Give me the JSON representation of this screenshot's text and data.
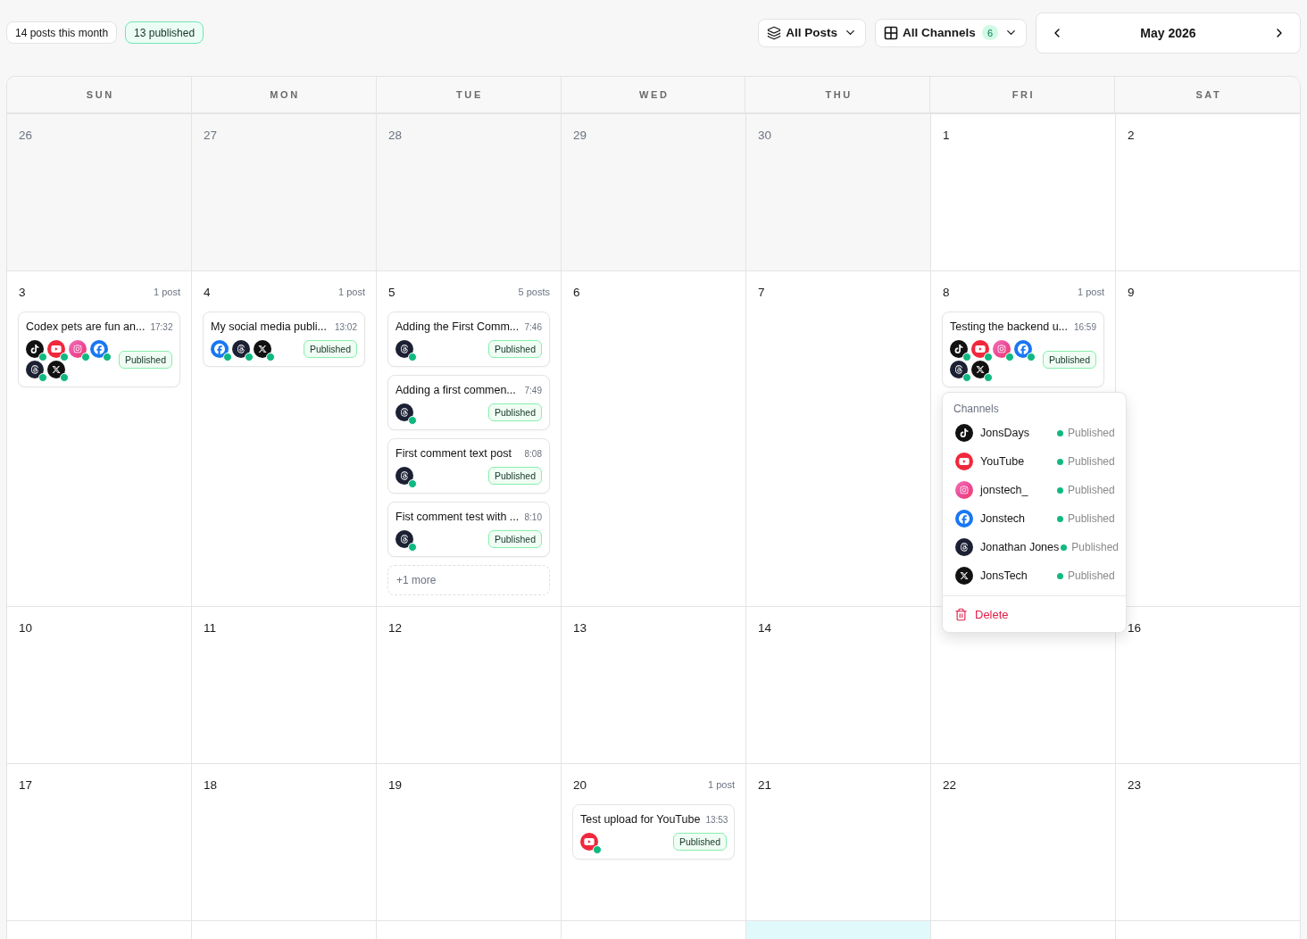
{
  "summary": {
    "posts_total": "14 posts this month",
    "published_total": "13 published"
  },
  "filters": [
    {
      "kind": "posts",
      "label": "All Posts"
    },
    {
      "kind": "channels",
      "label": "All Channels",
      "count": "6"
    }
  ],
  "month_nav": {
    "label": "May 2026"
  },
  "calendar": {
    "weekdays": [
      "SUN",
      "MON",
      "TUE",
      "WED",
      "THU",
      "FRI",
      "SAT"
    ],
    "weeks": [
      {
        "days": [
          {
            "number": "26",
            "outside_month": true,
            "today": false
          },
          {
            "number": "27",
            "outside_month": true,
            "today": false
          },
          {
            "number": "28",
            "outside_month": true,
            "today": false
          },
          {
            "number": "29",
            "outside_month": true,
            "today": false
          },
          {
            "number": "30",
            "outside_month": true,
            "today": false
          },
          {
            "number": "1",
            "outside_month": false,
            "today": false
          },
          {
            "number": "2",
            "outside_month": false,
            "today": false
          }
        ]
      },
      {
        "days": [
          {
            "number": "3",
            "outside_month": false,
            "today": false,
            "post_count": "1 post",
            "posts": [
              {
                "title": "Codex pets are fun an...",
                "time": "17:32",
                "status": "Published",
                "channels": [
                  {
                    "kind": "tiktok",
                    "published": true
                  },
                  {
                    "kind": "youtube",
                    "published": true
                  },
                  {
                    "kind": "instagram",
                    "published": true
                  },
                  {
                    "kind": "facebook",
                    "published": true
                  },
                  {
                    "kind": "threads",
                    "published": true
                  },
                  {
                    "kind": "x",
                    "published": true
                  }
                ]
              }
            ]
          },
          {
            "number": "4",
            "outside_month": false,
            "today": false,
            "post_count": "1 post",
            "posts": [
              {
                "title": "My social media publi...",
                "time": "13:02",
                "status": "Published",
                "channels": [
                  {
                    "kind": "facebook",
                    "published": true
                  },
                  {
                    "kind": "threads",
                    "published": true
                  },
                  {
                    "kind": "x",
                    "published": true
                  }
                ]
              }
            ]
          },
          {
            "number": "5",
            "outside_month": false,
            "today": false,
            "post_count": "5 posts",
            "posts": [
              {
                "title": "Adding the First Comm...",
                "time": "7:46",
                "status": "Published",
                "channels": [
                  {
                    "kind": "threads",
                    "published": true
                  }
                ]
              },
              {
                "title": "Adding a first commen...",
                "time": "7:49",
                "status": "Published",
                "channels": [
                  {
                    "kind": "threads",
                    "published": true
                  }
                ]
              },
              {
                "title": "First comment text post",
                "time": "8:08",
                "status": "Published",
                "channels": [
                  {
                    "kind": "threads",
                    "published": true
                  }
                ]
              },
              {
                "title": "Fist comment test with ...",
                "time": "8:10",
                "status": "Published",
                "channels": [
                  {
                    "kind": "threads",
                    "published": true
                  }
                ]
              }
            ],
            "more": "+1 more"
          },
          {
            "number": "6",
            "outside_month": false,
            "today": false
          },
          {
            "number": "7",
            "outside_month": false,
            "today": false
          },
          {
            "number": "8",
            "outside_month": false,
            "today": false,
            "post_count": "1 post",
            "posts": [
              {
                "title": "Testing the backend u...",
                "time": "16:59",
                "status": "Published",
                "channels": [
                  {
                    "kind": "tiktok",
                    "published": true
                  },
                  {
                    "kind": "youtube",
                    "published": true
                  },
                  {
                    "kind": "instagram",
                    "published": true
                  },
                  {
                    "kind": "facebook",
                    "published": true
                  },
                  {
                    "kind": "threads",
                    "published": true
                  },
                  {
                    "kind": "x",
                    "published": true
                  }
                ],
                "menu": {
                  "heading": "Channels",
                  "channels": [
                    {
                      "kind": "tiktok",
                      "name": "JonsDays",
                      "published": true,
                      "status": "Published"
                    },
                    {
                      "kind": "youtube",
                      "name": "YouTube",
                      "published": true,
                      "status": "Published"
                    },
                    {
                      "kind": "instagram",
                      "name": "jonstech_",
                      "published": true,
                      "status": "Published"
                    },
                    {
                      "kind": "facebook",
                      "name": "Jonstech",
                      "published": true,
                      "status": "Published"
                    },
                    {
                      "kind": "threads",
                      "name": "Jonathan Jones",
                      "published": true,
                      "status": "Published"
                    },
                    {
                      "kind": "x",
                      "name": "JonsTech",
                      "published": true,
                      "status": "Published"
                    }
                  ],
                  "delete_label": "Delete"
                }
              }
            ]
          },
          {
            "number": "9",
            "outside_month": false,
            "today": false
          }
        ]
      },
      {
        "days": [
          {
            "number": "10",
            "outside_month": false,
            "today": false
          },
          {
            "number": "11",
            "outside_month": false,
            "today": false
          },
          {
            "number": "12",
            "outside_month": false,
            "today": false
          },
          {
            "number": "13",
            "outside_month": false,
            "today": false
          },
          {
            "number": "14",
            "outside_month": false,
            "today": false
          },
          {
            "today": false
          },
          {
            "number": "16",
            "outside_month": false,
            "today": false
          }
        ]
      },
      {
        "days": [
          {
            "number": "17",
            "outside_month": false,
            "today": false
          },
          {
            "number": "18",
            "outside_month": false,
            "today": false
          },
          {
            "number": "19",
            "outside_month": false,
            "today": false
          },
          {
            "number": "20",
            "outside_month": false,
            "today": false,
            "post_count": "1 post",
            "posts": [
              {
                "title": "Test upload for YouTube",
                "time": "13:53",
                "status": "Published",
                "channels": [
                  {
                    "kind": "youtube",
                    "published": true
                  }
                ]
              }
            ]
          },
          {
            "number": "21",
            "outside_month": false,
            "today": false
          },
          {
            "number": "22",
            "outside_month": false,
            "today": false
          },
          {
            "number": "23",
            "outside_month": false,
            "today": false
          }
        ]
      },
      {
        "days": [
          {
            "today": false
          },
          {
            "today": false
          },
          {
            "today": false
          },
          {
            "today": false
          },
          {
            "today": true
          },
          {
            "today": false
          },
          {
            "today": false
          }
        ]
      }
    ]
  }
}
